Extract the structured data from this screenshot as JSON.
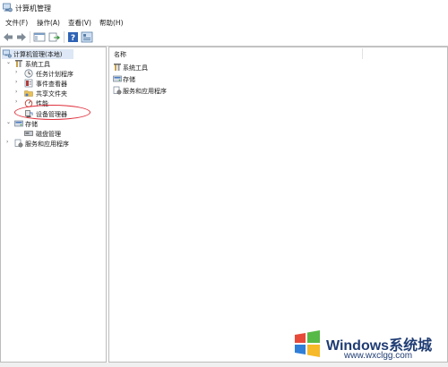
{
  "window": {
    "title": "计算机管理"
  },
  "menubar": {
    "items": [
      "文件(F)",
      "操作(A)",
      "查看(V)",
      "帮助(H)"
    ]
  },
  "toolbar": {
    "buttons": [
      "back-icon",
      "forward-icon",
      "console-tree-icon",
      "export-icon",
      "help-icon",
      "properties-icon"
    ]
  },
  "tree": {
    "root": "计算机管理(本地)",
    "system_tools": "系统工具",
    "task_scheduler": "任务计划程序",
    "event_viewer": "事件查看器",
    "shared_folders": "共享文件夹",
    "performance": "性能",
    "device_manager": "设备管理器",
    "storage": "存储",
    "disk_management": "磁盘管理",
    "services_apps": "服务和应用程序"
  },
  "list": {
    "column_name": "名称",
    "items": [
      "系统工具",
      "存储",
      "服务和应用程序"
    ]
  },
  "watermark": {
    "title": "Windows系统城",
    "url": "www.wxclgg.com"
  },
  "colors": {
    "selection": "#dde7f5",
    "annotation": "#e0303c",
    "watermark": "#1f3c73"
  }
}
